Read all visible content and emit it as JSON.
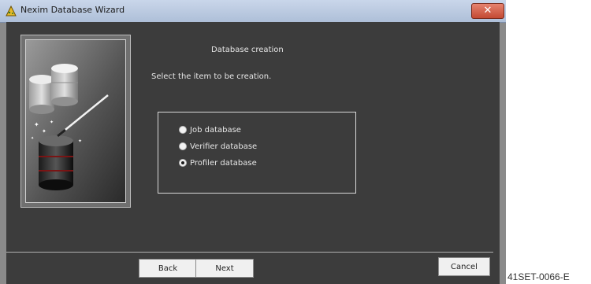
{
  "window": {
    "title": "Nexim Database Wizard",
    "close_symbol": "✕",
    "app_icon": "wizard-hat-icon"
  },
  "wizard": {
    "heading": "Database creation",
    "instruction": "Select the item to be creation.",
    "options": [
      {
        "label": "Job database",
        "selected": false
      },
      {
        "label": "Verifier database",
        "selected": false
      },
      {
        "label": "Profiler database",
        "selected": true
      }
    ]
  },
  "buttons": {
    "back": "Back",
    "next": "Next",
    "cancel": "Cancel"
  },
  "caption": "41SET-0066-E",
  "colors": {
    "client_background": "#3c3c3c",
    "close_button": "#c34a33",
    "title_bar": "#b9c9e0"
  }
}
